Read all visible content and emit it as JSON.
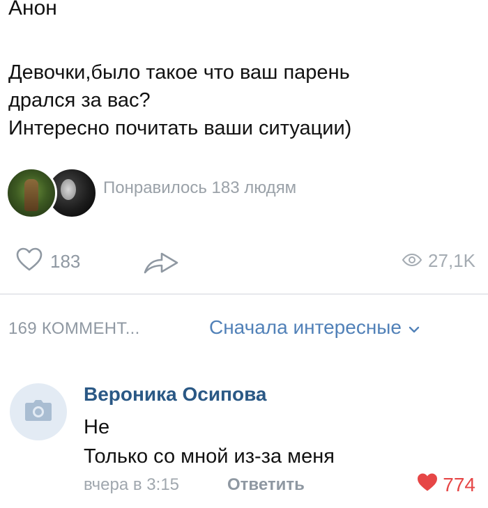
{
  "post": {
    "author": "Анон",
    "lines": [
      "Девочки,было такое что ваш парень",
      "дрался за вас?",
      "Интересно почитать ваши ситуации)"
    ],
    "liked_by_text": "Понравилось 183 людям"
  },
  "actions": {
    "like_count": "183",
    "views": "27,1K"
  },
  "comments_header": {
    "count_label": "169 КОММЕНТ...",
    "sort_label": "Сначала интересные"
  },
  "comment": {
    "author": "Вероника Осипова",
    "lines": [
      "Не",
      "Только со мной из-за меня"
    ],
    "time": "вчера в 3:15",
    "reply_label": "Ответить",
    "likes": "774"
  },
  "colors": {
    "link": "#2a5885",
    "accent": "#5181b8",
    "muted": "#8f98a2",
    "heart": "#e64646"
  },
  "icons": [
    "heart-outline-icon",
    "share-arrow-icon",
    "eye-icon",
    "chevron-down-icon",
    "camera-icon",
    "heart-filled-icon"
  ]
}
